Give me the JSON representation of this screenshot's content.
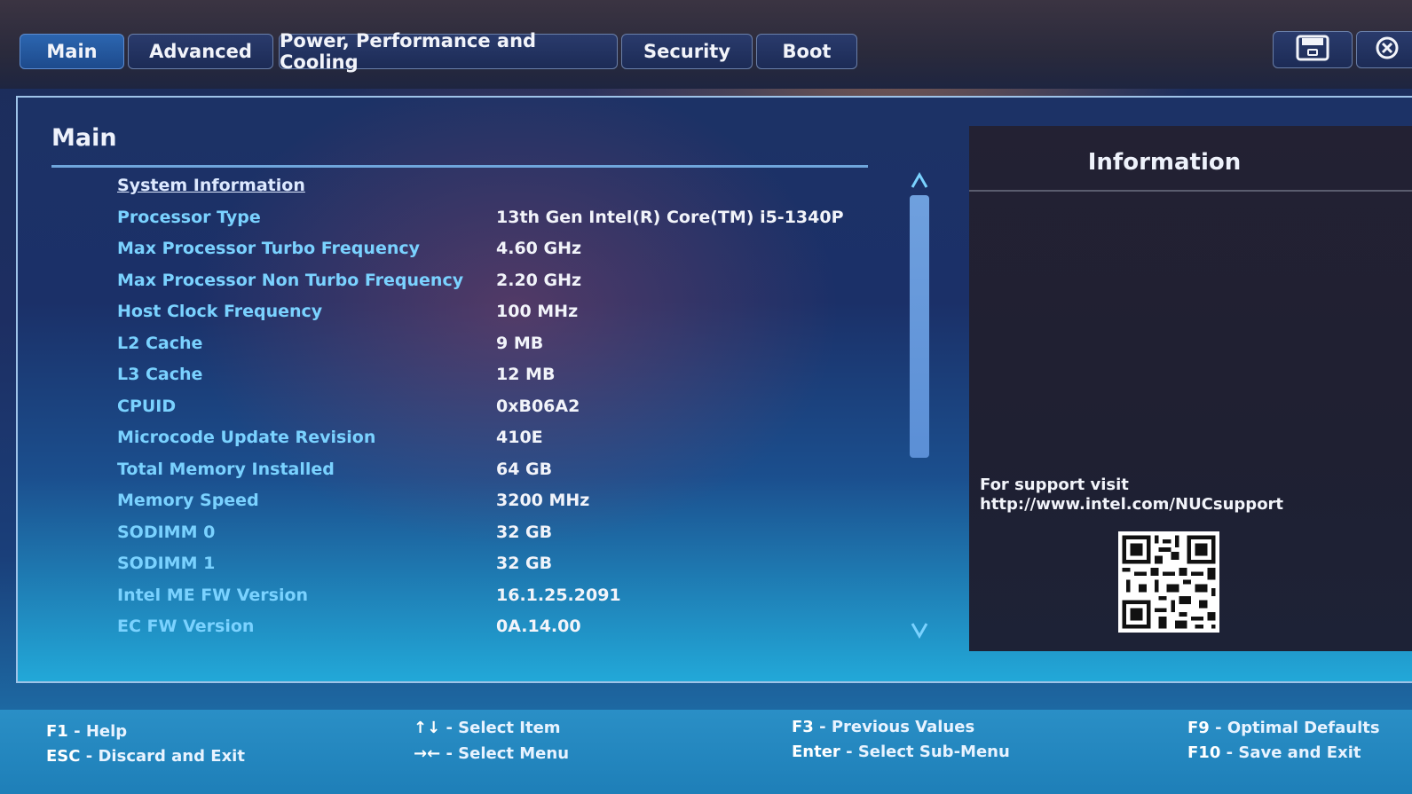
{
  "tabs": [
    {
      "label": "Main",
      "active": true
    },
    {
      "label": "Advanced",
      "active": false
    },
    {
      "label": "Power, Performance and Cooling",
      "active": false
    },
    {
      "label": "Security",
      "active": false
    },
    {
      "label": "Boot",
      "active": false
    }
  ],
  "toolbar": {
    "save_icon": "save-icon",
    "exit_icon": "close-icon"
  },
  "main": {
    "title": "Main",
    "section_heading": "System Information",
    "rows": [
      {
        "label": "Processor Type",
        "value": "13th Gen Intel(R) Core(TM) i5-1340P"
      },
      {
        "label": "Max Processor Turbo Frequency",
        "value": "4.60 GHz"
      },
      {
        "label": "Max Processor Non Turbo Frequency",
        "value": "2.20 GHz"
      },
      {
        "label": "Host Clock Frequency",
        "value": "100 MHz"
      },
      {
        "label": "L2 Cache",
        "value": "9 MB"
      },
      {
        "label": "L3 Cache",
        "value": "12 MB"
      },
      {
        "label": "CPUID",
        "value": "0xB06A2"
      },
      {
        "label": "Microcode Update Revision",
        "value": "410E"
      },
      {
        "label": "Total Memory Installed",
        "value": "64 GB"
      },
      {
        "label": "Memory Speed",
        "value": "3200 MHz"
      },
      {
        "label": "SODIMM 0",
        "value": "32 GB"
      },
      {
        "label": "SODIMM 1",
        "value": "32 GB"
      },
      {
        "label": "Intel ME FW Version",
        "value": "16.1.25.2091"
      },
      {
        "label": "EC FW Version",
        "value": "0A.14.00"
      }
    ],
    "scroll_up_glyph": "^",
    "scroll_down_glyph": "v"
  },
  "info": {
    "title": "Information",
    "support_line1": "For support visit",
    "support_line2": "http://www.intel.com/NUCsupport",
    "qr_icon": "qr-code-icon"
  },
  "footer": {
    "f1_key": "F1",
    "f1_text": " - Help",
    "esc_key": "ESC",
    "esc_text": " - Discard and Exit",
    "updown_key": "↑↓",
    "updown_text": " - Select Item",
    "leftright_key": "→←",
    "leftright_text": " - Select Menu",
    "f3_key": "F3",
    "f3_text": " - Previous Values",
    "enter_key": "Enter",
    "enter_text": " - Select Sub-Menu",
    "f9_key": "F9",
    "f9_text": " - Optimal Defaults",
    "f10_key": "F10",
    "f10_text": " - Save and Exit"
  },
  "colors": {
    "label": "#7ad2ff",
    "value": "#f2f4fa",
    "active_tab": "#2c66b0",
    "footer": "#2a8fc6"
  }
}
